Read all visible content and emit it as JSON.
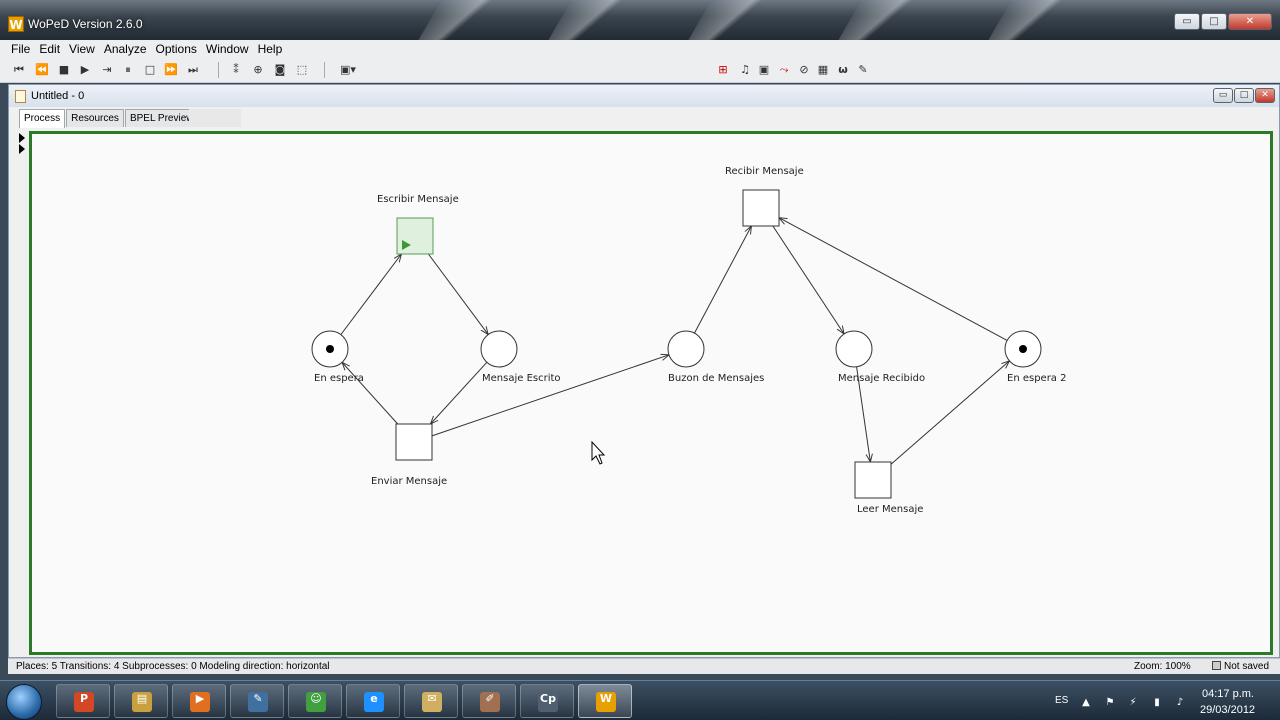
{
  "window": {
    "title": "WoPeD Version 2.6.0",
    "logo_letter": "W",
    "minimize": "▭",
    "maximize": "□",
    "close": "✕"
  },
  "menu": [
    "File",
    "Edit",
    "View",
    "Analyze",
    "Options",
    "Window",
    "Help"
  ],
  "toolbar": {
    "left_icons": [
      "first-icon",
      "rewind-icon",
      "stop-icon",
      "play-icon",
      "step-icon",
      "pause-icon",
      "stop-square-icon",
      "fast-forward-icon",
      "last-icon",
      "footprints-icon",
      "zoom-icon",
      "token-icon",
      "select-icon",
      "tool-icon"
    ],
    "right_icons": [
      "coverability-icon",
      "bell-icon",
      "screen-icon",
      "graph-icon",
      "quantitative-icon",
      "film-icon",
      "omega-icon",
      "paint-icon"
    ]
  },
  "frame": {
    "title": "Untitled - 0",
    "tabs": [
      "Process",
      "Resources",
      "BPEL Preview"
    ]
  },
  "net": {
    "places": [
      {
        "id": "p1",
        "label": "En espera",
        "token": true
      },
      {
        "id": "p2",
        "label": "Mensaje Escrito",
        "token": false
      },
      {
        "id": "p3",
        "label": "Buzon de Mensajes",
        "token": false
      },
      {
        "id": "p4",
        "label": "Mensaje Recibido",
        "token": false
      },
      {
        "id": "p5",
        "label": "En espera 2",
        "token": true
      }
    ],
    "transitions": [
      {
        "id": "t1",
        "label": "Escribir Mensaje",
        "enabled": true
      },
      {
        "id": "t2",
        "label": "Enviar Mensaje",
        "enabled": false
      },
      {
        "id": "t3",
        "label": "Recibir Mensaje",
        "enabled": false
      },
      {
        "id": "t4",
        "label": "Leer Mensaje",
        "enabled": false
      }
    ],
    "arcs": [
      [
        "p1",
        "t1"
      ],
      [
        "t1",
        "p2"
      ],
      [
        "p2",
        "t2"
      ],
      [
        "t2",
        "p1"
      ],
      [
        "t2",
        "p3"
      ],
      [
        "p3",
        "t3"
      ],
      [
        "t3",
        "p4"
      ],
      [
        "p4",
        "t4"
      ],
      [
        "t4",
        "p5"
      ],
      [
        "p5",
        "t3"
      ]
    ]
  },
  "status": {
    "info": "Places: 5  Transitions: 4  Subprocesses: 0  Modeling direction: horizontal",
    "zoom": "Zoom: 100%",
    "saved": "Not saved"
  },
  "taskbar": {
    "apps": [
      {
        "name": "PowerPoint",
        "glyph": "P",
        "color": "#d24726"
      },
      {
        "name": "Explorer",
        "glyph": "▤",
        "color": "#c8a040"
      },
      {
        "name": "Media",
        "glyph": "▶",
        "color": "#e07020"
      },
      {
        "name": "Tool",
        "glyph": "✎",
        "color": "#4070a0"
      },
      {
        "name": "Messenger",
        "glyph": "☺",
        "color": "#40a040"
      },
      {
        "name": "Internet Explorer",
        "glyph": "e",
        "color": "#1e90ff"
      },
      {
        "name": "Notes",
        "glyph": "✉",
        "color": "#d0b060"
      },
      {
        "name": "Paint",
        "glyph": "✐",
        "color": "#a07050"
      },
      {
        "name": "Captivate",
        "glyph": "Cp",
        "color": "#506070"
      },
      {
        "name": "WoPeD",
        "glyph": "W",
        "color": "#e8a000"
      }
    ],
    "language": "ES",
    "time": "04:17 p.m.",
    "date": "29/03/2012"
  }
}
